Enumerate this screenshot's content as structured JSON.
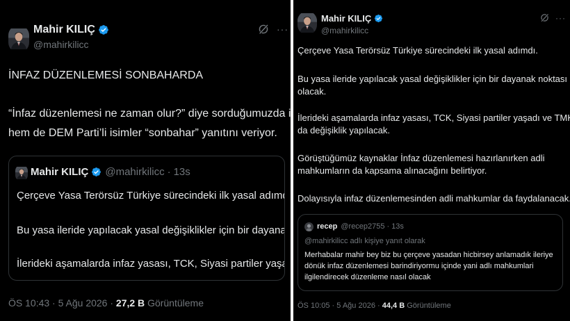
{
  "left_tweet": {
    "author": {
      "name": "Mahir KILIÇ",
      "handle": "@mahirkilicc"
    },
    "headline": "İNFAZ DÜZENLEMESİ SONBAHARDA",
    "body_lines": [
      "“İnfaz düzenlemesi ne zaman olur?” diye sorduğumuzda ise hem MHP",
      "hem de DEM Parti’li isimler “sonbahar” yanıtını veriyor."
    ],
    "quote": {
      "name": "Mahir KILIÇ",
      "handle": "@mahirkilicc",
      "separator": "·",
      "time": "13s",
      "lines": [
        "Çerçeve Yasa Terörsüz Türkiye sürecindeki ilk yasal adımdı.",
        "Bu yasa ileride yapılacak yasal değişiklikler için bir dayanak noktası olacak.",
        "İlerideki aşamalarda infaz yasası, TCK, Siyasi partiler yaşadı ve TMK’da da ..."
      ]
    },
    "meta": {
      "time": "ÖS 10:43",
      "separator": "·",
      "date": "5 Ağu 2026",
      "views_count": "27,2 B",
      "views_label": "Görüntüleme"
    }
  },
  "right_tweet": {
    "author": {
      "name": "Mahir KILIÇ",
      "handle": "@mahirkilicc"
    },
    "paragraphs": [
      [
        "Çerçeve Yasa Terörsüz Türkiye sürecindeki ilk yasal adımdı."
      ],
      [
        "Bu yasa ileride yapılacak yasal değişiklikler için bir dayanak noktası",
        "olacak."
      ],
      [
        "İlerideki aşamalarda infaz yasası, TCK, Siyasi partiler yaşadı ve TMK’da",
        "da değişiklik yapılacak."
      ],
      [
        "Görüştüğümüz kaynaklar İnfaz düzenlemesi hazırlanırken adli",
        "mahkumların da kapsama alınacağını belirtiyor."
      ],
      [
        "Dolayısıyla infaz düzenlemesinden adli mahkumlar da faydalanacak."
      ]
    ],
    "quote": {
      "name": "recep",
      "handle": "@recep2755",
      "separator": "·",
      "time": "13s",
      "reply_note": "@mahirkilicc adlı kişiye yanıt olarak",
      "lines": [
        "Merhabalar mahir bey biz bu çerçeve yasadan hicbirsey anlamadık ileriye",
        "dönük infaz düzenlemesi barindiriyormu içinde yani adlı mahkumlari",
        "ilgilendirecek düzenleme nasıl olacak"
      ]
    },
    "meta": {
      "time": "ÖS 10:05",
      "separator": "·",
      "date": "5 Ağu 2026",
      "views_count": "44,4 B",
      "views_label": "Görüntüleme"
    }
  },
  "icons": {
    "verified": "verified-badge-icon",
    "grok": "grok-icon",
    "more": "more-icon",
    "more_glyph": "···"
  },
  "colors": {
    "background": "#000000",
    "text": "#e7e9ea",
    "secondary": "#71767b",
    "border": "#2f3336",
    "verified": "#1d9bf0"
  }
}
